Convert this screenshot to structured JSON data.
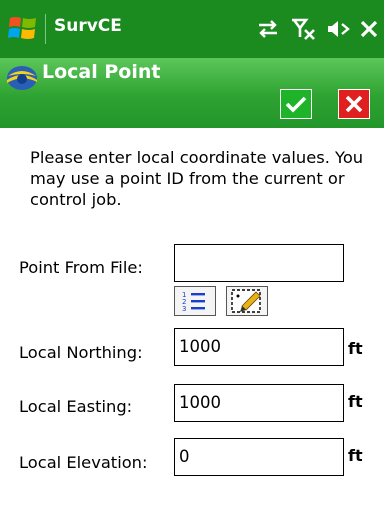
{
  "statusbar": {
    "app_title": "SurvCE",
    "icons": [
      "windows-logo-icon",
      "sync-arrows-icon",
      "no-signal-icon",
      "volume-muted-icon",
      "close-icon"
    ]
  },
  "dialog": {
    "title": "Local Point",
    "ok_icon": "checkmark-icon",
    "cancel_icon": "x-icon",
    "instructions": "Please enter local coordinate values. You may use a point ID from the current or control job."
  },
  "fields": {
    "point_from_file": {
      "label": "Point From File:",
      "value": ""
    },
    "local_northing": {
      "label": "Local Northing:",
      "value": "1000",
      "unit": "ft"
    },
    "local_easting": {
      "label": "Local Easting:",
      "value": "1000",
      "unit": "ft"
    },
    "local_elevation": {
      "label": "Local Elevation:",
      "value": "0",
      "unit": "ft"
    }
  },
  "tools": [
    "point-list-icon",
    "map-pick-icon"
  ]
}
